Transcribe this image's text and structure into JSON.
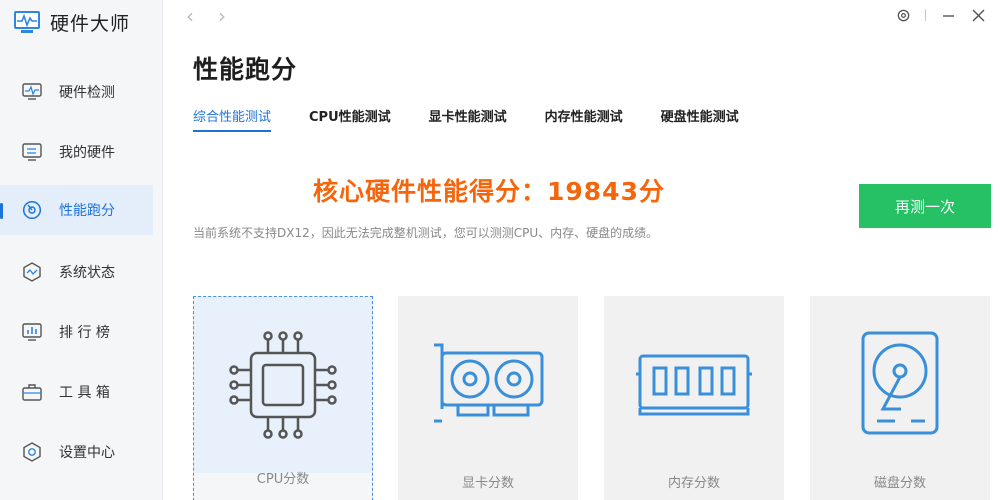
{
  "app": {
    "name": "硬件大师"
  },
  "sidebar": {
    "items": [
      {
        "label": "硬件检测",
        "icon": "monitor-pulse-icon"
      },
      {
        "label": "我的硬件",
        "icon": "hardware-list-icon"
      },
      {
        "label": "性能跑分",
        "icon": "speedometer-icon",
        "active": true
      },
      {
        "label": "系统状态",
        "icon": "system-status-icon"
      },
      {
        "label": "排 行 榜",
        "icon": "ranking-chart-icon"
      },
      {
        "label": "工 具 箱",
        "icon": "toolbox-icon"
      },
      {
        "label": "设置中心",
        "icon": "settings-hexagon-icon"
      }
    ]
  },
  "topbar": {
    "back": "‹",
    "forward": "›"
  },
  "main": {
    "title": "性能跑分",
    "tabs": [
      {
        "label": "综合性能测试",
        "active": true
      },
      {
        "label": "CPU性能测试"
      },
      {
        "label": "显卡性能测试"
      },
      {
        "label": "内存性能测试"
      },
      {
        "label": "硬盘性能测试"
      }
    ],
    "score_text": "核心硬件性能得分：19843分",
    "notice": "当前系统不支持DX12，因此无法完成整机测试，您可以测测CPU、内存、硬盘的成绩。",
    "retest_label": "再测一次",
    "cards": [
      {
        "label": "CPU分数",
        "icon": "cpu-chip-icon",
        "selected": true
      },
      {
        "label": "显卡分数",
        "icon": "graphics-card-icon"
      },
      {
        "label": "内存分数",
        "icon": "memory-stick-icon"
      },
      {
        "label": "磁盘分数",
        "icon": "hard-disk-icon"
      }
    ]
  },
  "colors": {
    "accent": "#1a73d9",
    "score": "#f5650c",
    "button": "#26c165",
    "icon": "#3a8fd9"
  }
}
